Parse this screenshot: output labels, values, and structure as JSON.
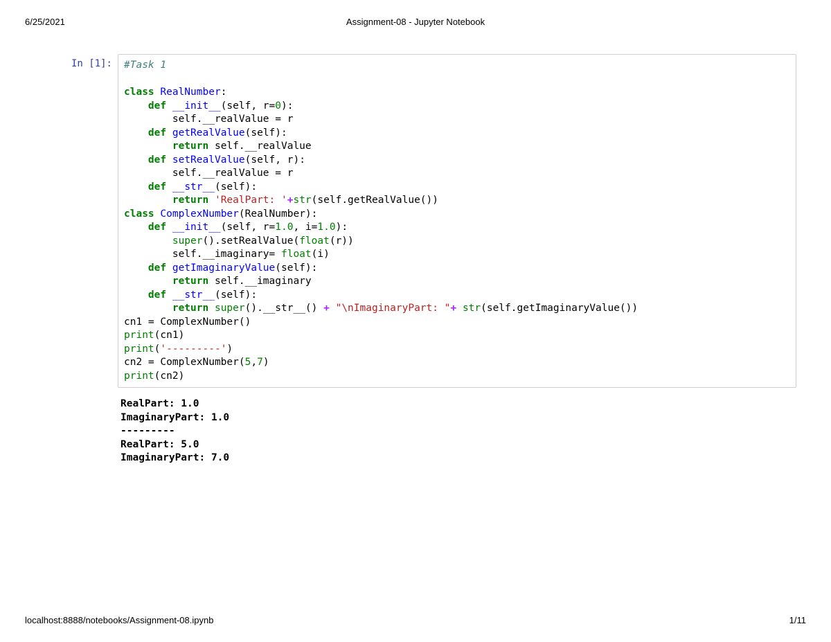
{
  "header": {
    "date": "6/25/2021",
    "title": "Assignment-08 - Jupyter Notebook"
  },
  "footer": {
    "path": "localhost:8888/notebooks/Assignment-08.ipynb",
    "page": "1/11"
  },
  "cell": {
    "prompt": "In [1]:",
    "code": {
      "l01_comment": "#Task 1",
      "l02": "",
      "l03_kw": "class",
      "l03_name": "RealNumber",
      "l03_colon": ":",
      "l04_indent": "    ",
      "l04_kw": "def",
      "l04_name": "__init__",
      "l04_rest_a": "(self, r=",
      "l04_num": "0",
      "l04_rest_b": "):",
      "l05_indent": "        ",
      "l05_text": "self.__realValue = r",
      "l06_indent": "    ",
      "l06_kw": "def",
      "l06_name": "getRealValue",
      "l06_rest": "(self):",
      "l07_indent": "        ",
      "l07_kw": "return",
      "l07_text": " self.__realValue",
      "l08_indent": "    ",
      "l08_kw": "def",
      "l08_name": "setRealValue",
      "l08_rest": "(self, r):",
      "l09_indent": "        ",
      "l09_text": "self.__realValue = r",
      "l10_indent": "    ",
      "l10_kw": "def",
      "l10_name": "__str__",
      "l10_rest": "(self):",
      "l11_indent": "        ",
      "l11_kw": "return",
      "l11_str": " 'RealPart: '",
      "l11_op": "+",
      "l11_builtin": "str",
      "l11_tail": "(self.getRealValue())",
      "l12_kw": "class",
      "l12_name": "ComplexNumber",
      "l12_rest": "(RealNumber):",
      "l13_indent": "    ",
      "l13_kw": "def",
      "l13_name": "__init__",
      "l13_a": "(self, r=",
      "l13_n1": "1.0",
      "l13_b": ", i=",
      "l13_n2": "1.0",
      "l13_c": "):",
      "l14_indent": "        ",
      "l14_builtin": "super",
      "l14_a": "().setRealValue(",
      "l14_builtin2": "float",
      "l14_b": "(r))",
      "l15_indent": "        ",
      "l15_a": "self.__imaginary= ",
      "l15_builtin": "float",
      "l15_b": "(i)",
      "l16_indent": "    ",
      "l16_kw": "def",
      "l16_name": "getImaginaryValue",
      "l16_rest": "(self):",
      "l17_indent": "        ",
      "l17_kw": "return",
      "l17_text": " self.__imaginary",
      "l18_indent": "    ",
      "l18_kw": "def",
      "l18_name": "__str__",
      "l18_rest": "(self):",
      "l19_indent": "        ",
      "l19_kw": "return",
      "l19_sp": " ",
      "l19_builtin": "super",
      "l19_a": "().__str__() ",
      "l19_op1": "+",
      "l19_str": " \"\\nImaginaryPart: \"",
      "l19_op2": "+",
      "l19_sp2": " ",
      "l19_builtin2": "str",
      "l19_b": "(self.getImaginaryValue())",
      "l20": "cn1 = ComplexNumber()",
      "l21_builtin": "print",
      "l21_rest": "(cn1)",
      "l22_builtin": "print",
      "l22_a": "(",
      "l22_str": "'---------'",
      "l22_b": ")",
      "l23_a": "cn2 = ComplexNumber(",
      "l23_n1": "5",
      "l23_comma": ",",
      "l23_n2": "7",
      "l23_b": ")",
      "l24_builtin": "print",
      "l24_rest": "(cn2)"
    },
    "output": "RealPart: 1.0\nImaginaryPart: 1.0\n---------\nRealPart: 5.0\nImaginaryPart: 7.0"
  }
}
